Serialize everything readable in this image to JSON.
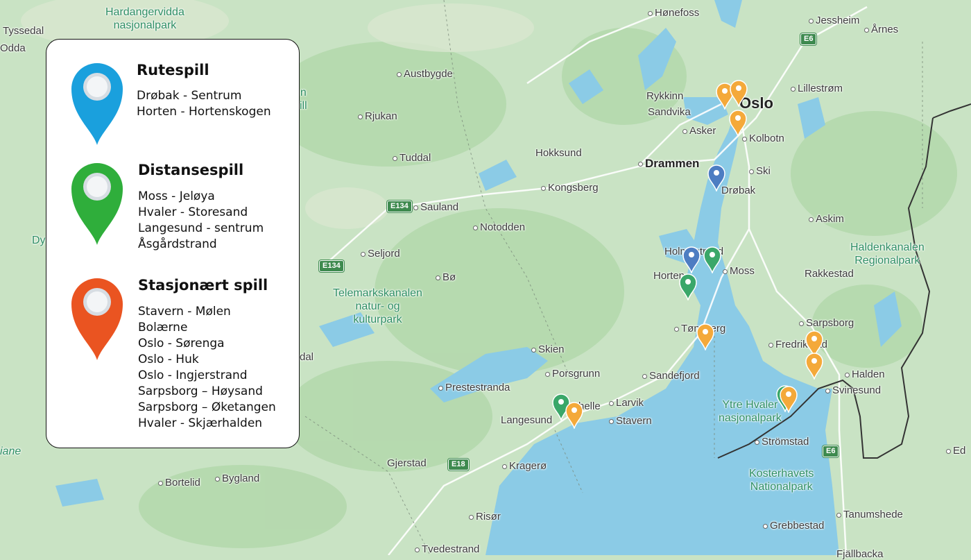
{
  "legend": {
    "groups": [
      {
        "title": "Rutespill",
        "color": "#1aa0dd",
        "items": [
          "Drøbak - Sentrum",
          "Horten - Hortenskogen"
        ]
      },
      {
        "title": "Distansespill",
        "color": "#2fae3b",
        "items": [
          "Moss - Jeløya",
          "Hvaler - Storesand",
          "Langesund - sentrum",
          "Åsgårdstrand"
        ]
      },
      {
        "title": "Stasjonært spill",
        "color": "#ea5421",
        "items": [
          "Stavern - Mølen",
          "Bolærne",
          "Oslo - Sørenga",
          "Oslo - Huk",
          "Oslo - Ingjerstrand",
          "Sarpsborg – Høysand",
          "Sarpsborg – Øketangen",
          "Hvaler - Skjærhalden"
        ]
      }
    ]
  },
  "map": {
    "colors": {
      "land": "#c9e3c4",
      "water": "#8bcbe6",
      "forest": "#b4d8ad",
      "border": "#333333"
    },
    "marker_colors": {
      "blue": "#4d7dc2",
      "green": "#3aa769",
      "orange": "#f4a93a"
    },
    "labels": {
      "tyssedal": "Tyssedal",
      "odda": "Odda",
      "hardanger": "Hardangervidda\nnasjonalpark",
      "austbygde": "Austbygde",
      "rjukan": "Rjukan",
      "tuddal": "Tuddal",
      "sauland": "Sauland",
      "notodden": "Notodden",
      "seljord": "Seljord",
      "bo": "Bø",
      "telemark": "Telemarkskanalen\nnatur- og\nkulturpark",
      "skien": "Skien",
      "porsgrunn": "Porsgrunn",
      "prestestranda": "Prestestranda",
      "langesund": "Langesund",
      "helle": "helle",
      "larvik": "Larvik",
      "stavern": "Stavern",
      "gjerstad": "Gjerstad",
      "kragero": "Kragerø",
      "risor": "Risør",
      "tvedestrand": "Tvedestrand",
      "bortelid": "Bortelid",
      "bygland": "Bygland",
      "honefoss": "Hønefoss",
      "jessheim": "Jessheim",
      "arnes": "Årnes",
      "rykkinn": "Rykkinn",
      "sandvika": "Sandvika",
      "oslo": "Oslo",
      "lillestrom": "Lillestrøm",
      "asker": "Asker",
      "kolbotn": "Kolbotn",
      "hokksund": "Hokksund",
      "drammen": "Drammen",
      "ski": "Ski",
      "kongsberg": "Kongsberg",
      "drobak": "Drøbak",
      "askim": "Askim",
      "holmestrand": "Holmestrand",
      "moss": "Moss",
      "horten": "Horten",
      "rakkestad": "Rakkestad",
      "haldenkanalen": "Haldenkanalen\nRegionalpark",
      "tonsberg": "Tønsberg",
      "sarpsborg": "Sarpsborg",
      "fredrikstad": "Fredrikstad",
      "sandefjord": "Sandefjord",
      "halden": "Halden",
      "svinesund": "Svinesund",
      "ytrehvaler": "Ytre Hvaler\nnasjonalpark",
      "stromstad": "Strömstad",
      "kosterhavet": "Kosterhavets\nNationalpark",
      "grebbestad": "Grebbestad",
      "tanumshede": "Tanumshede",
      "ed": "Ed",
      "dy": "Dy",
      "dal": "dal",
      "iane": "iane",
      "ntill": "n\nill",
      "fjallbacka": "Fjällbacka"
    },
    "shields": {
      "e134a": "E134",
      "e134b": "E134",
      "e18": "E18",
      "e6a": "E6",
      "e6b": "E6"
    }
  }
}
